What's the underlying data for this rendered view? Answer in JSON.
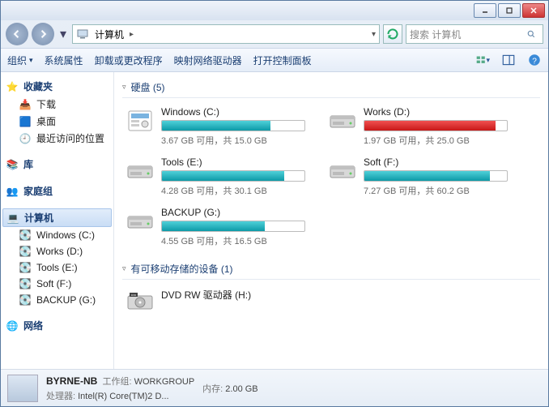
{
  "title": "计算机",
  "breadcrumb": [
    "计算机"
  ],
  "search_placeholder": "搜索 计算机",
  "toolbar": {
    "organize": "组织",
    "sys_props": "系统属性",
    "uninstall": "卸载或更改程序",
    "map_drive": "映射网络驱动器",
    "control_panel": "打开控制面板"
  },
  "sidebar": {
    "favorites": {
      "label": "收藏夹",
      "items": [
        "下载",
        "桌面",
        "最近访问的位置"
      ]
    },
    "libraries": {
      "label": "库"
    },
    "homegroup": {
      "label": "家庭组"
    },
    "computer": {
      "label": "计算机",
      "items": [
        "Windows (C:)",
        "Works (D:)",
        "Tools (E:)",
        "Soft (F:)",
        "BACKUP (G:)"
      ]
    },
    "network": {
      "label": "网络"
    }
  },
  "sections": {
    "hdd_label": "硬盘 (5)",
    "removable_label": "有可移动存储的设备 (1)"
  },
  "drives": [
    {
      "name": "Windows (C:)",
      "free": "3.67 GB 可用，共 15.0 GB",
      "pct": 76,
      "warn": false,
      "sys": true
    },
    {
      "name": "Works (D:)",
      "free": "1.97 GB 可用，共 25.0 GB",
      "pct": 92,
      "warn": true,
      "sys": false
    },
    {
      "name": "Tools (E:)",
      "free": "4.28 GB 可用，共 30.1 GB",
      "pct": 86,
      "warn": false,
      "sys": false
    },
    {
      "name": "Soft (F:)",
      "free": "7.27 GB 可用，共 60.2 GB",
      "pct": 88,
      "warn": false,
      "sys": false
    },
    {
      "name": "BACKUP (G:)",
      "free": "4.55 GB 可用，共 16.5 GB",
      "pct": 72,
      "warn": false,
      "sys": false
    }
  ],
  "optical": {
    "name": "DVD RW 驱动器 (H:)"
  },
  "status": {
    "computer_name": "BYRNE-NB",
    "workgroup_label": "工作组:",
    "workgroup": "WORKGROUP",
    "cpu_label": "处理器:",
    "cpu": "Intel(R) Core(TM)2 D...",
    "mem_label": "内存:",
    "mem": "2.00 GB"
  }
}
